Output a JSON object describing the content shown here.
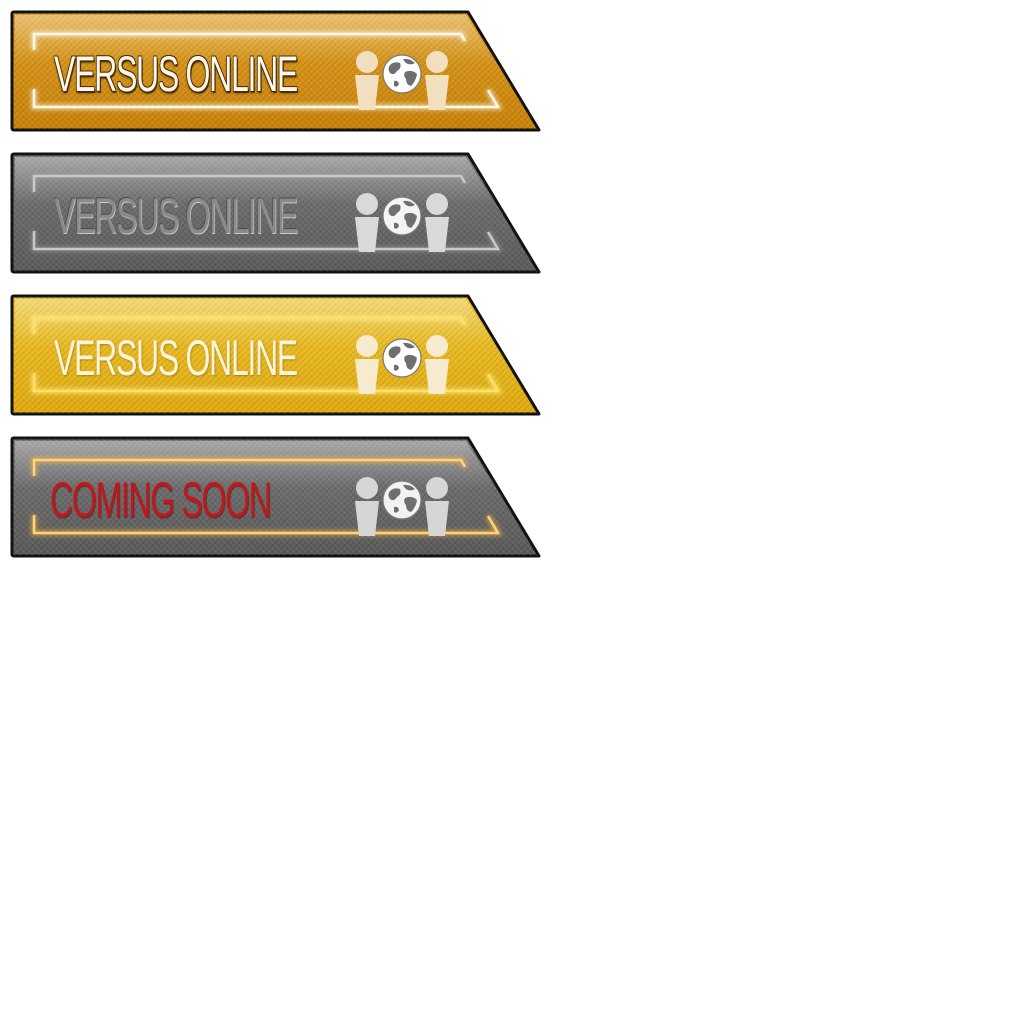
{
  "buttons": [
    {
      "state": "normal",
      "label": "VERSUS ONLINE",
      "icon": "versus-players-globe-icon",
      "colors": {
        "fill_top": "#e0a126",
        "fill_bottom": "#c98208",
        "frame": "#fff8e6",
        "frame_glow": "#ffffff",
        "icon": "#f1dfc0",
        "globe": "#ffffff"
      }
    },
    {
      "state": "disabled",
      "label": "VERSUS ONLINE",
      "icon": "versus-players-globe-icon",
      "colors": {
        "fill_top": "#7a7a7a",
        "fill_bottom": "#5b5b5b",
        "frame": "#c9c9c9",
        "frame_glow": "#9a9a9a",
        "icon": "#d9d9d9",
        "globe": "#f4f4f4"
      }
    },
    {
      "state": "hover",
      "label": "VERSUS ONLINE",
      "icon": "versus-players-globe-icon",
      "colors": {
        "fill_top": "#efc530",
        "fill_bottom": "#e0ab10",
        "frame": "#ffe060",
        "frame_glow": "#fff2a0",
        "icon": "#f6ebcf",
        "globe": "#ffffff"
      }
    },
    {
      "state": "coming-soon",
      "label": "COMING SOON",
      "icon": "versus-players-globe-icon",
      "colors": {
        "fill_top": "#7a7a7a",
        "fill_bottom": "#5a5a5a",
        "frame": "#ffd27a",
        "frame_glow": "#ffb640",
        "icon": "#d6d6d6",
        "globe": "#f2f2f2",
        "label": "#c0181a"
      }
    }
  ]
}
